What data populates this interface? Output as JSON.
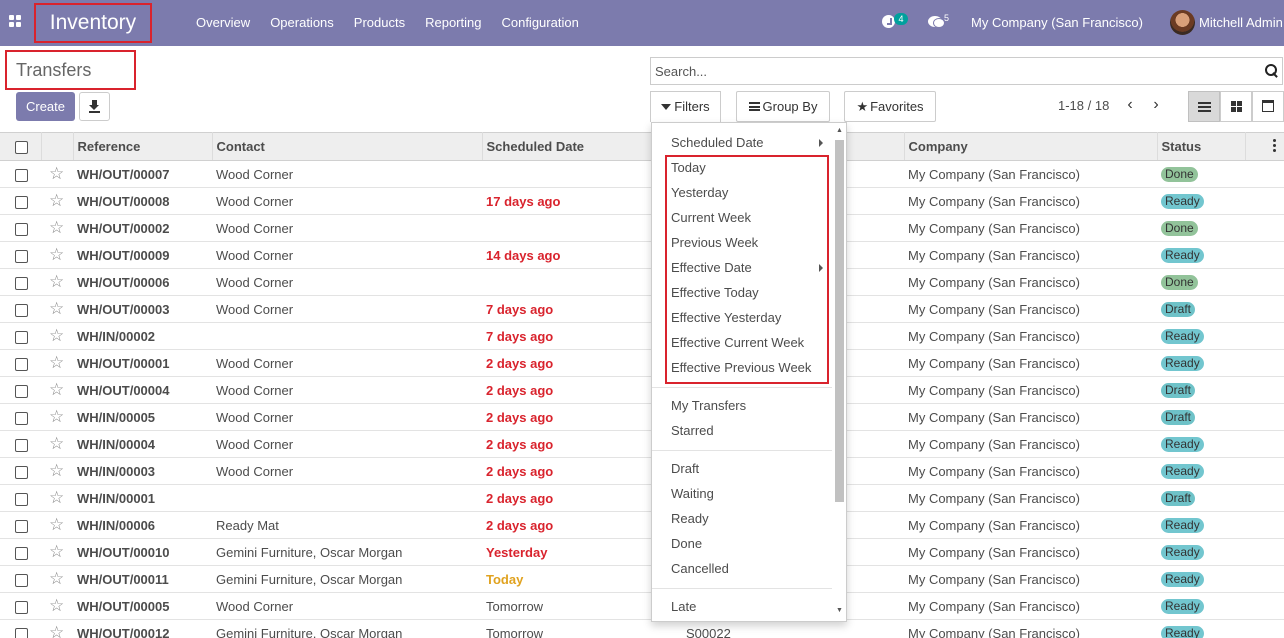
{
  "navbar": {
    "app_name": "Inventory",
    "menu": [
      "Overview",
      "Operations",
      "Products",
      "Reporting",
      "Configuration"
    ],
    "activity_count": "4",
    "message_count": "5",
    "company": "My Company (San Francisco)",
    "user": "Mitchell Admin"
  },
  "control_panel": {
    "breadcrumb": "Transfers",
    "create_label": "Create",
    "search_placeholder": "Search...",
    "filters_label": "Filters",
    "groupby_label": "Group By",
    "favorites_label": "Favorites",
    "pager": "1-18 / 18"
  },
  "filters_dropdown": {
    "items": [
      {
        "label": "Scheduled Date",
        "submenu": true
      },
      {
        "label": "Today"
      },
      {
        "label": "Yesterday"
      },
      {
        "label": "Current Week"
      },
      {
        "label": "Previous Week"
      },
      {
        "label": "Effective Date",
        "submenu": true
      },
      {
        "label": "Effective Today"
      },
      {
        "label": "Effective Yesterday"
      },
      {
        "label": "Effective Current Week"
      },
      {
        "label": "Effective Previous Week"
      },
      {
        "label": "My Transfers"
      },
      {
        "label": "Starred"
      },
      {
        "label": "Draft"
      },
      {
        "label": "Waiting"
      },
      {
        "label": "Ready"
      },
      {
        "label": "Done"
      },
      {
        "label": "Cancelled"
      },
      {
        "label": "Late"
      }
    ]
  },
  "table": {
    "columns": [
      "Reference",
      "Contact",
      "Scheduled Date",
      "Company",
      "Status"
    ],
    "rows": [
      {
        "reference": "WH/OUT/00007",
        "contact": "Wood Corner",
        "scheduled": "",
        "scheduled_style": "normal",
        "source": "",
        "company": "My Company (San Francisco)",
        "status": "Done"
      },
      {
        "reference": "WH/OUT/00008",
        "contact": "Wood Corner",
        "scheduled": "17 days ago",
        "scheduled_style": "late",
        "source": "",
        "company": "My Company (San Francisco)",
        "status": "Ready"
      },
      {
        "reference": "WH/OUT/00002",
        "contact": "Wood Corner",
        "scheduled": "",
        "scheduled_style": "normal",
        "source": "",
        "company": "My Company (San Francisco)",
        "status": "Done"
      },
      {
        "reference": "WH/OUT/00009",
        "contact": "Wood Corner",
        "scheduled": "14 days ago",
        "scheduled_style": "late",
        "source": "",
        "company": "My Company (San Francisco)",
        "status": "Ready"
      },
      {
        "reference": "WH/OUT/00006",
        "contact": "Wood Corner",
        "scheduled": "",
        "scheduled_style": "normal",
        "source": "",
        "company": "My Company (San Francisco)",
        "status": "Done"
      },
      {
        "reference": "WH/OUT/00003",
        "contact": "Wood Corner",
        "scheduled": "7 days ago",
        "scheduled_style": "late",
        "source": "",
        "company": "My Company (San Francisco)",
        "status": "Draft"
      },
      {
        "reference": "WH/IN/00002",
        "contact": "",
        "scheduled": "7 days ago",
        "scheduled_style": "late",
        "source": "",
        "company": "My Company (San Francisco)",
        "status": "Ready"
      },
      {
        "reference": "WH/OUT/00001",
        "contact": "Wood Corner",
        "scheduled": "2 days ago",
        "scheduled_style": "late",
        "source": "",
        "company": "My Company (San Francisco)",
        "status": "Ready"
      },
      {
        "reference": "WH/OUT/00004",
        "contact": "Wood Corner",
        "scheduled": "2 days ago",
        "scheduled_style": "late",
        "source": "",
        "company": "My Company (San Francisco)",
        "status": "Draft"
      },
      {
        "reference": "WH/IN/00005",
        "contact": "Wood Corner",
        "scheduled": "2 days ago",
        "scheduled_style": "late",
        "source": "",
        "company": "My Company (San Francisco)",
        "status": "Draft"
      },
      {
        "reference": "WH/IN/00004",
        "contact": "Wood Corner",
        "scheduled": "2 days ago",
        "scheduled_style": "late",
        "source": "",
        "company": "My Company (San Francisco)",
        "status": "Ready"
      },
      {
        "reference": "WH/IN/00003",
        "contact": "Wood Corner",
        "scheduled": "2 days ago",
        "scheduled_style": "late",
        "source": "",
        "company": "My Company (San Francisco)",
        "status": "Ready"
      },
      {
        "reference": "WH/IN/00001",
        "contact": "",
        "scheduled": "2 days ago",
        "scheduled_style": "late",
        "source": "",
        "company": "My Company (San Francisco)",
        "status": "Draft"
      },
      {
        "reference": "WH/IN/00006",
        "contact": "Ready Mat",
        "scheduled": "2 days ago",
        "scheduled_style": "late",
        "source": "",
        "company": "My Company (San Francisco)",
        "status": "Ready"
      },
      {
        "reference": "WH/OUT/00010",
        "contact": "Gemini Furniture, Oscar Morgan",
        "scheduled": "Yesterday",
        "scheduled_style": "late",
        "source": "",
        "company": "My Company (San Francisco)",
        "status": "Ready"
      },
      {
        "reference": "WH/OUT/00011",
        "contact": "Gemini Furniture, Oscar Morgan",
        "scheduled": "Today",
        "scheduled_style": "today",
        "source": "",
        "company": "My Company (San Francisco)",
        "status": "Ready"
      },
      {
        "reference": "WH/OUT/00005",
        "contact": "Wood Corner",
        "scheduled": "Tomorrow",
        "scheduled_style": "normal",
        "source": "",
        "company": "My Company (San Francisco)",
        "status": "Ready"
      },
      {
        "reference": "WH/OUT/00012",
        "contact": "Gemini Furniture, Oscar Morgan",
        "scheduled": "Tomorrow",
        "scheduled_style": "normal",
        "source": "S00022",
        "company": "My Company (San Francisco)",
        "status": "Ready"
      }
    ]
  },
  "colors": {
    "navbar": "#7c7bad",
    "highlight_box": "#d9232d",
    "late_date": "#d9232d",
    "today_date": "#e0a21f",
    "badge_ready": "#72c6cf",
    "badge_done": "#92c39a"
  }
}
